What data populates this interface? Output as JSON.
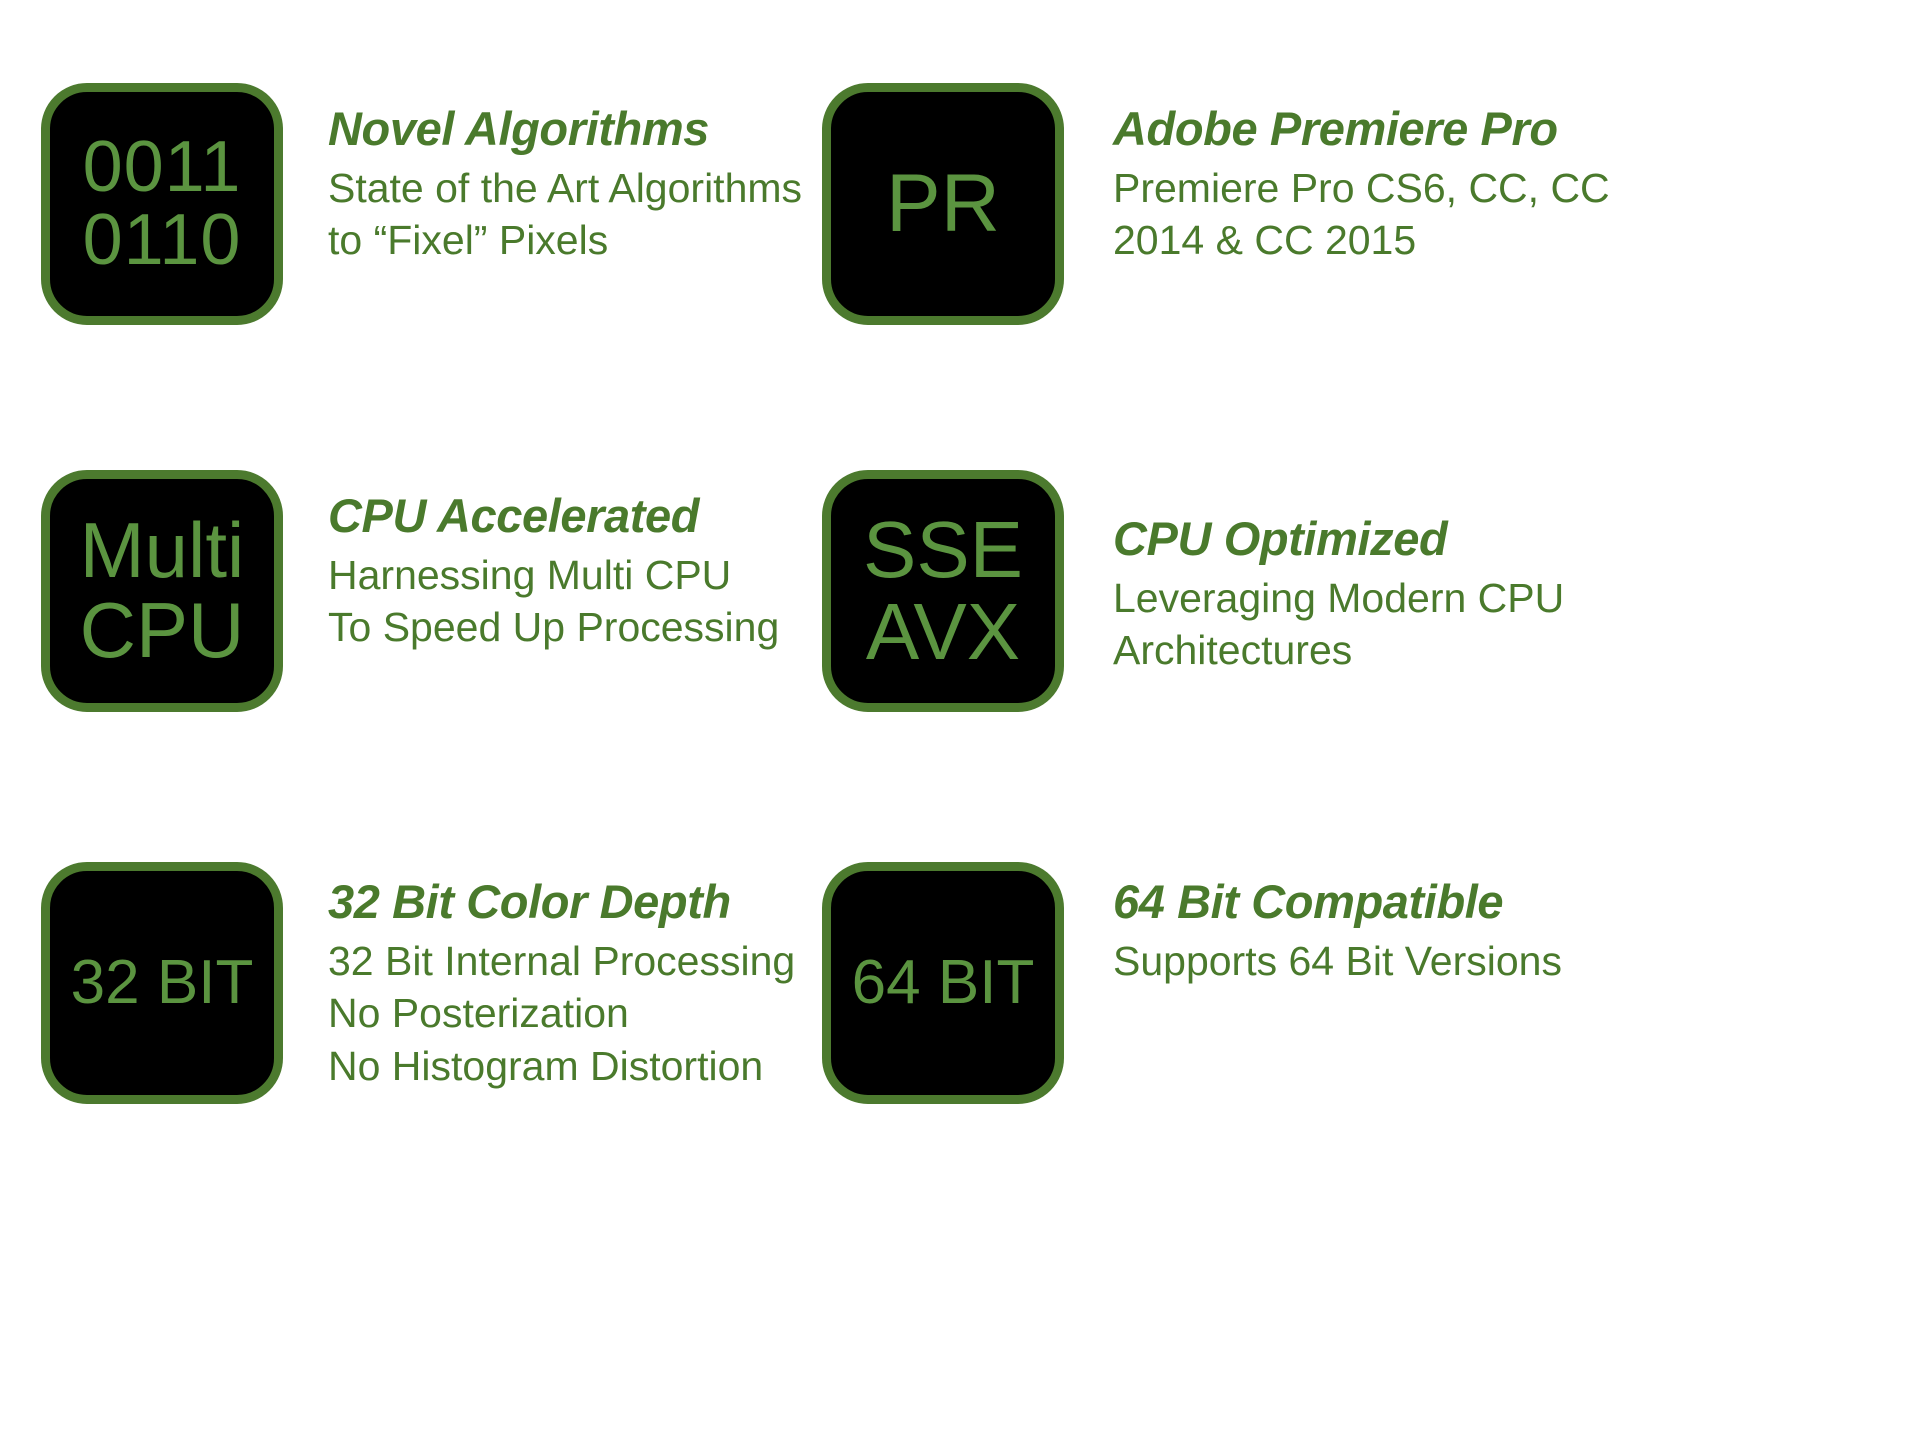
{
  "page": {
    "background_color": "#ffffff",
    "accent_green": "#4a7a2c",
    "tile_border_green": "#4c7a2e",
    "tile_glyph_green": "#5b9440",
    "tile_background": "#000000"
  },
  "features": [
    {
      "icon_name": "binary-code-icon",
      "icon_lines": [
        "0011",
        "0110"
      ],
      "heading": "Novel Algorithms",
      "lines": [
        "State of the Art Algorithms",
        "to “Fixel” Pixels"
      ]
    },
    {
      "icon_name": "adobe-premiere-pro-icon",
      "icon_lines": [
        "PR"
      ],
      "heading": "Adobe Premiere Pro",
      "lines": [
        "Premiere Pro CS6, CC, CC",
        "2014 & CC 2015"
      ]
    },
    {
      "icon_name": "multi-cpu-icon",
      "icon_lines": [
        "Multi",
        "CPU"
      ],
      "heading": "CPU Accelerated",
      "lines": [
        "Harnessing Multi CPU",
        "To Speed Up Processing"
      ]
    },
    {
      "icon_name": "sse-avx-icon",
      "icon_lines": [
        "SSE",
        "AVX"
      ],
      "heading": "CPU Optimized",
      "lines": [
        "Leveraging Modern CPU",
        "Architectures"
      ]
    },
    {
      "icon_name": "32-bit-icon",
      "icon_lines": [
        "32 BIT"
      ],
      "heading": "32 Bit Color Depth",
      "lines": [
        "32 Bit Internal Processing",
        "No Posterization",
        "No Histogram Distortion"
      ]
    },
    {
      "icon_name": "64-bit-icon",
      "icon_lines": [
        "64 BIT"
      ],
      "heading": "64 Bit Compatible",
      "lines": [
        "Supports 64 Bit Versions"
      ]
    }
  ]
}
